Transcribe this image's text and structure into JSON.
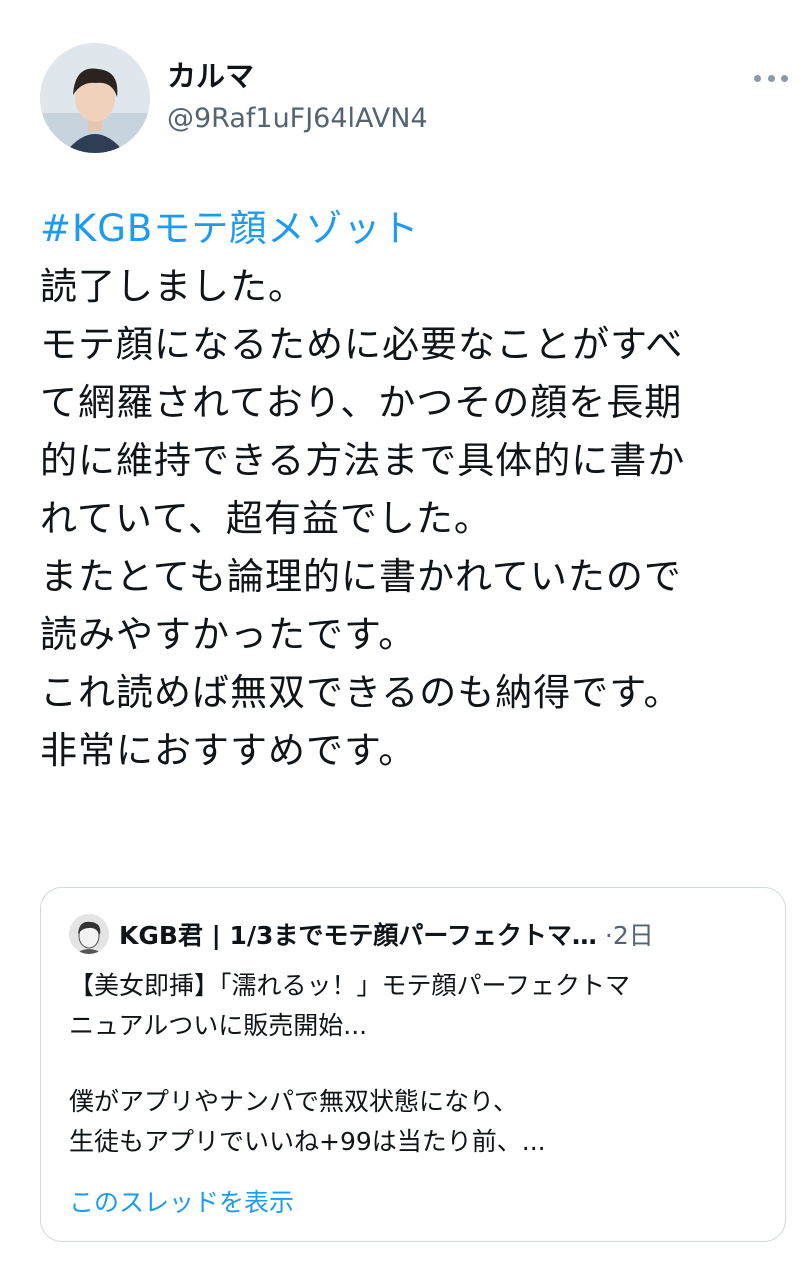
{
  "author": {
    "name": "カルマ",
    "handle": "@9Raf1uFJ64lAVN4"
  },
  "tweet": {
    "hashtag": "#KGBモテ顔メゾット",
    "lines": [
      "読了しました。",
      "モテ顔になるために必要なことがすべ",
      "て網羅されており、かつその顔を長期",
      "的に維持できる方法まで具体的に書か",
      "れていて、超有益でした。",
      "またとても論理的に書かれていたので",
      "読みやすかったです。",
      "これ読めば無双できるのも納得です。",
      "非常におすすめです。"
    ]
  },
  "quoted": {
    "name": "KGB君 | 1/3までモテ顔パーフェクトマ…",
    "time": "·2日",
    "lines": [
      "【美女即挿】「濡れるッ！」モテ顔パーフェクトマ",
      "ニュアルついに販売開始..."
    ],
    "lines2": [
      "僕がアプリやナンパで無双状態になり、",
      "生徒もアプリでいいね+99は当たり前、..."
    ],
    "show_thread": "このスレッドを表示"
  },
  "colors": {
    "link": "#1d9bf0",
    "secondary_text": "#536471",
    "border": "#cfd9de"
  },
  "icons": [
    "more-icon"
  ]
}
